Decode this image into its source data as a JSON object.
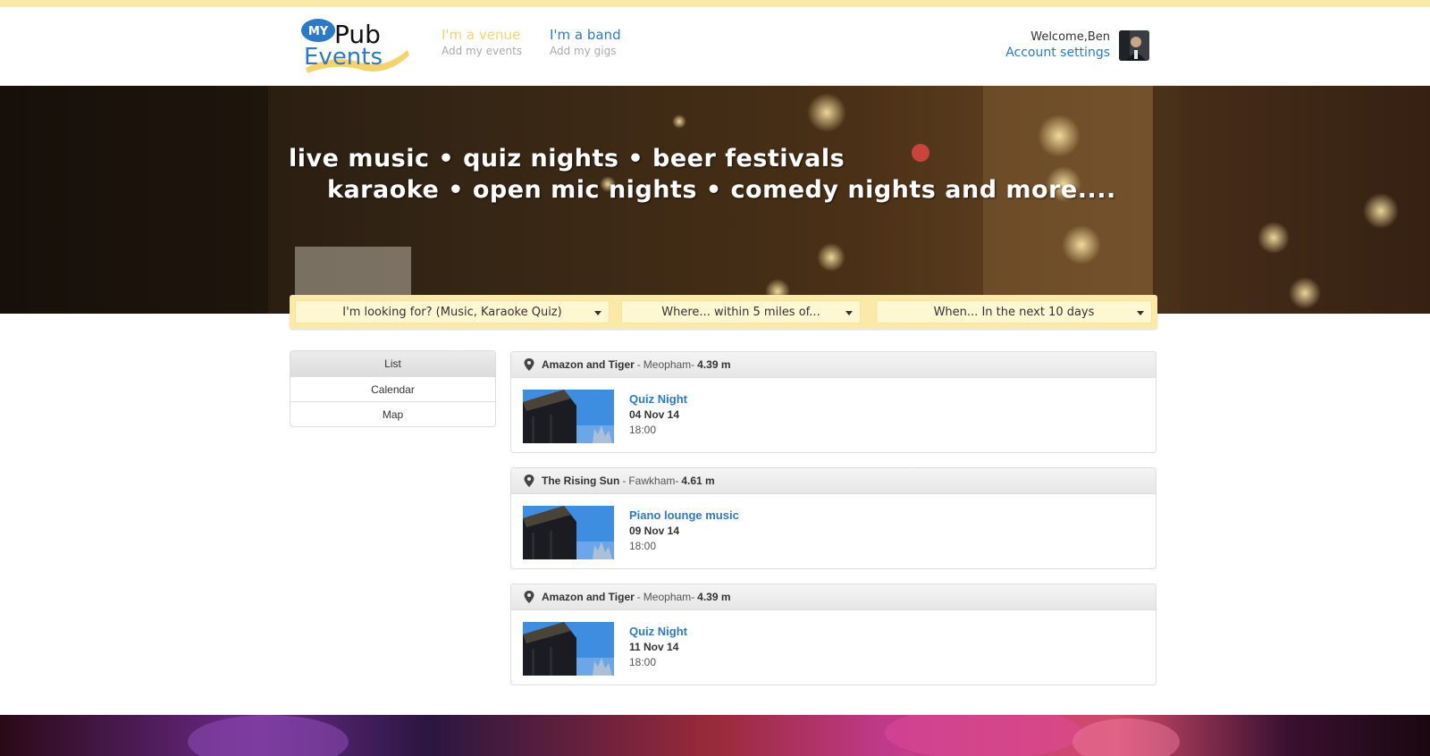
{
  "header": {
    "logo": {
      "line1": "MY",
      "line2": "Pub",
      "line3": "Events"
    },
    "nav": [
      {
        "title": "I'm a venue",
        "subtitle": "Add my events"
      },
      {
        "title": "I'm a band",
        "subtitle": "Add my gigs"
      }
    ],
    "user": {
      "welcome": "Welcome,Ben",
      "account_link": "Account settings"
    }
  },
  "hero": {
    "tagline_line1": "live music • quiz nights • beer festivals",
    "tagline_line2": "karaoke • open mic nights • comedy nights and more...."
  },
  "filters": {
    "what": "I'm looking for? (Music, Karaoke Quiz)",
    "where": "Where... within 5 miles of...",
    "when": "When... In the next 10 days"
  },
  "side_nav": {
    "items": [
      "List",
      "Calendar",
      "Map"
    ],
    "active": "List"
  },
  "events": [
    {
      "venue": "Amazon and Tiger",
      "town": "Meopham",
      "distance": "4.39 m",
      "title": "Quiz Night",
      "date": "04 Nov 14",
      "time": "18:00"
    },
    {
      "venue": "The Rising Sun",
      "town": "Fawkham",
      "distance": "4.61 m",
      "title": "Piano lounge music",
      "date": "09 Nov 14",
      "time": "18:00"
    },
    {
      "venue": "Amazon and Tiger",
      "town": "Meopham",
      "distance": "4.39 m",
      "title": "Quiz Night",
      "date": "11 Nov 14",
      "time": "18:00"
    }
  ],
  "colors": {
    "accent_yellow": "#fbe9a8",
    "link_blue": "#2a7ac7",
    "venue_yellow": "#f6d36a"
  }
}
